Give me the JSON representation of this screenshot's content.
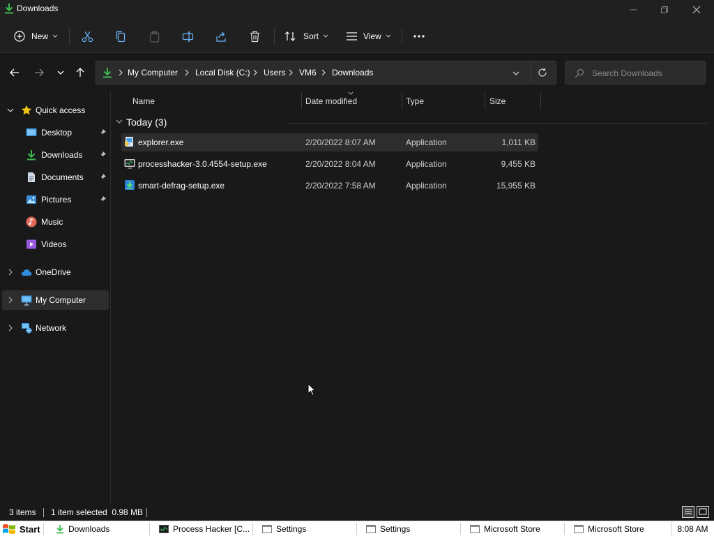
{
  "window": {
    "title": "Downloads"
  },
  "toolbar": {
    "new_label": "New",
    "sort_label": "Sort",
    "view_label": "View"
  },
  "address": {
    "crumbs": [
      "My Computer",
      "Local Disk (C:)",
      "Users",
      "VM6",
      "Downloads"
    ]
  },
  "search": {
    "placeholder": "Search Downloads"
  },
  "sidebar": {
    "quick_access": "Quick access",
    "items": [
      {
        "label": "Desktop",
        "icon": "desktop-icon",
        "pinned": true
      },
      {
        "label": "Downloads",
        "icon": "download-icon",
        "pinned": true
      },
      {
        "label": "Documents",
        "icon": "document-icon",
        "pinned": true
      },
      {
        "label": "Pictures",
        "icon": "pictures-icon",
        "pinned": true
      },
      {
        "label": "Music",
        "icon": "music-icon",
        "pinned": false
      },
      {
        "label": "Videos",
        "icon": "videos-icon",
        "pinned": false
      }
    ],
    "onedrive": "OneDrive",
    "my_computer": "My Computer",
    "network": "Network"
  },
  "columns": {
    "name": "Name",
    "date": "Date modified",
    "type": "Type",
    "size": "Size"
  },
  "group": {
    "label": "Today (3)"
  },
  "files": [
    {
      "name": "explorer.exe",
      "date": "2/20/2022 8:07 AM",
      "type": "Application",
      "size": "1,011 KB",
      "selected": true
    },
    {
      "name": "processhacker-3.0.4554-setup.exe",
      "date": "2/20/2022 8:04 AM",
      "type": "Application",
      "size": "9,455 KB",
      "selected": false
    },
    {
      "name": "smart-defrag-setup.exe",
      "date": "2/20/2022 7:58 AM",
      "type": "Application",
      "size": "15,955 KB",
      "selected": false
    }
  ],
  "status": {
    "item_count": "3 items",
    "selection": "1 item selected  0.98 MB"
  },
  "taskbar": {
    "start": "Start",
    "tasks": [
      "Downloads",
      "Process Hacker [C...",
      "Settings",
      "Settings",
      "Microsoft Store",
      "Microsoft Store"
    ],
    "clock": "8:08 AM"
  },
  "colors": {
    "background": "#191919",
    "chrome": "#202020",
    "selection": "#2d2d2d",
    "accent_green": "#3fb950",
    "folder_yellow": "#f5c518"
  }
}
